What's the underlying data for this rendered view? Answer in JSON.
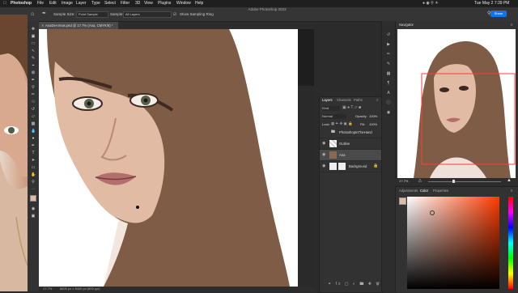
{
  "menubar": {
    "apple_icon": "apple-icon",
    "app_name": "Photoshop",
    "menus": [
      "File",
      "Edit",
      "Image",
      "Layer",
      "Type",
      "Select",
      "Filter",
      "3D",
      "View",
      "Plugins",
      "Window",
      "Help"
    ],
    "clock": "Tue May 2  7:39 PM"
  },
  "window": {
    "title": "Adobe Photoshop 2023"
  },
  "options_bar": {
    "sample_size_label": "Sample Size:",
    "sample_size_value": "Point Sample",
    "sample_label": "Sample:",
    "sample_value": "All Layers",
    "show_ring_label": "Show Sampling Ring",
    "share_label": "Share"
  },
  "document": {
    "tab_title": "AnaDeArmas.psd @ 17.7% (Ana, CMYK/8) *",
    "zoom": "17.7%",
    "doc_info": "8600 px x 8400 px (600 ppi)"
  },
  "layers_panel": {
    "tabs": [
      "Layers",
      "Channels",
      "Paths"
    ],
    "filter_kind": "Kind",
    "blend_mode": "Normal",
    "opacity_label": "Opacity:",
    "opacity_value": "100%",
    "lock_label": "Lock:",
    "fill_label": "Fill:",
    "fill_value": "100%",
    "layers": [
      {
        "name": "PhotoshopInTheHand"
      },
      {
        "name": "Outline"
      },
      {
        "name": "Ana"
      },
      {
        "name": "Background"
      }
    ]
  },
  "navigator": {
    "title": "Navigator",
    "zoom": "17.7%"
  },
  "color_panel": {
    "tabs": [
      "Adjustments",
      "Color",
      "Properties"
    ]
  },
  "colors": {
    "accent": "#1473e6",
    "hair": "#7d5a42",
    "skin": "#e2bba5",
    "nav_rect": "#ff3b3b"
  }
}
